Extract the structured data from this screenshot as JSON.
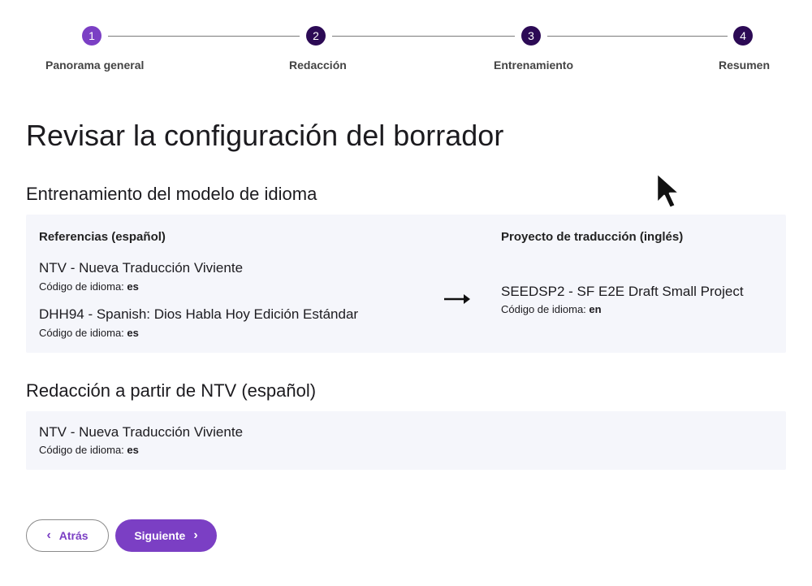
{
  "stepper": {
    "steps": [
      {
        "number": "1",
        "label": "Panorama general",
        "state": "active"
      },
      {
        "number": "2",
        "label": "Redacción",
        "state": "pending"
      },
      {
        "number": "3",
        "label": "Entrenamiento",
        "state": "pending"
      },
      {
        "number": "4",
        "label": "Resumen",
        "state": "pending"
      }
    ]
  },
  "page_title": "Revisar la configuración del borrador",
  "training": {
    "title": "Entrenamiento del modelo de idioma",
    "references_header": "Referencias (español)",
    "target_header": "Proyecto de traducción (inglés)",
    "references": [
      {
        "name": "NTV - Nueva Traducción Viviente",
        "lang_label": "Código de idioma:",
        "lang_code": "es"
      },
      {
        "name": "DHH94 - Spanish: Dios Habla Hoy Edición Estándar",
        "lang_label": "Código de idioma:",
        "lang_code": "es"
      }
    ],
    "target": {
      "name": "SEEDSP2 - SF E2E Draft Small Project",
      "lang_label": "Código de idioma:",
      "lang_code": "en"
    }
  },
  "drafting": {
    "title": "Redacción a partir de NTV (español)",
    "source": {
      "name": "NTV - Nueva Traducción Viviente",
      "lang_label": "Código de idioma:",
      "lang_code": "es"
    }
  },
  "buttons": {
    "back_label": "Atrás",
    "next_label": "Siguiente"
  },
  "colors": {
    "accent": "#7b3fc4",
    "step_pending": "#2c0a55",
    "card_background": "#f5f6fb"
  }
}
